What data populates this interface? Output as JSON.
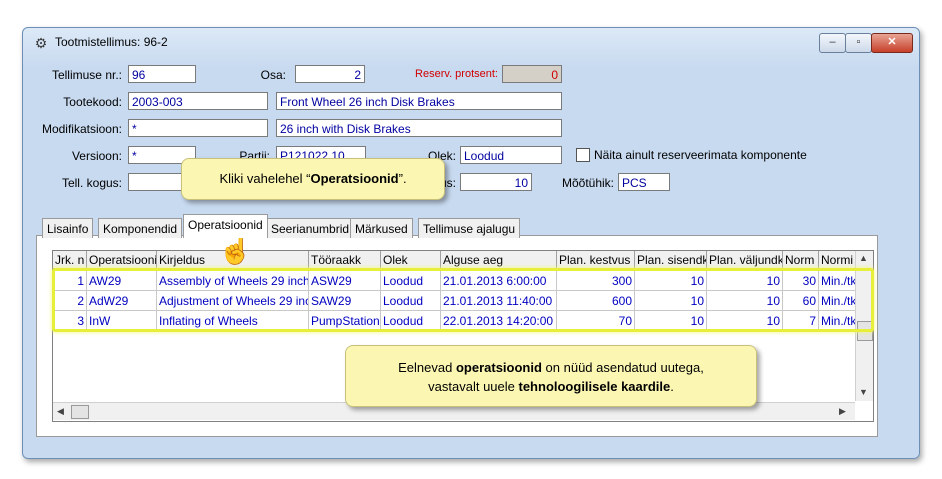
{
  "window": {
    "title": "Tootmistellimus: 96-2",
    "icon": "gear-icon",
    "controls": {
      "minimize": "‒",
      "maximize": "▫",
      "close": "✕"
    }
  },
  "form": {
    "order_nr_label": "Tellimuse nr.:",
    "order_nr_value": "96",
    "part_label": "Osa:",
    "part_value": "2",
    "reserv_label": "Reserv. protsent:",
    "reserv_value": "0",
    "product_code_label": "Tootekood:",
    "product_code_value": "2003-003",
    "product_name": "Front Wheel 26 inch Disk Brakes",
    "modification_label": "Modifikatsioon:",
    "modification_value": "*",
    "modification_desc": "26 inch with Disk Brakes",
    "version_label": "Versioon:",
    "version_value": "*",
    "batch_label_partial": "Partii:",
    "batch_value": "P121022.10",
    "status_label": "Olek:",
    "status_value": "Loodud",
    "show_unreserved_label": "Näita ainult reserveerimata komponente",
    "order_qty_label": "Tell. kogus:",
    "qty_label_partial": "us:",
    "qty_value": "10",
    "unit_label": "Mõõtühik:",
    "unit_value": "PCS"
  },
  "tabs": [
    "Lisainfo",
    "Komponendid",
    "Operatsioonid",
    "Seerianumbrid",
    "Märkused",
    "Tellimuse ajalugu"
  ],
  "active_tab": "Operatsioonid",
  "grid": {
    "headers": [
      "Jrk. n",
      "Operatsiooni",
      "Kirjeldus",
      "Tööraakk",
      "Olek",
      "Alguse aeg",
      "Plan. kestvus",
      "Plan. sisendk",
      "Plan. väljundk",
      "Norm",
      "Normi üh"
    ],
    "rows": [
      [
        "1",
        "AW29",
        "Assembly of Wheels 29 inch",
        "ASW29",
        "Loodud",
        "21.01.2013 6:00:00",
        "300",
        "10",
        "10",
        "30",
        "Min./tk"
      ],
      [
        "2",
        "AdW29",
        "Adjustment of Wheels 29 inc",
        "SAW29",
        "Loodud",
        "21.01.2013 11:40:00",
        "600",
        "10",
        "10",
        "60",
        "Min./tk"
      ],
      [
        "3",
        "InW",
        "Inflating of Wheels",
        "PumpStation",
        "Loodud",
        "22.01.2013 14:20:00",
        "70",
        "10",
        "10",
        "7",
        "Min./tk"
      ]
    ]
  },
  "callouts": {
    "tab_hint_prefix": "Kliki vahelehel “",
    "tab_hint_bold": "Operatsioonid",
    "tab_hint_suffix": "”.",
    "result_1": "Eelnevad ",
    "result_bold1": "operatsioonid",
    "result_2": " on nüüd asendatud uutega,",
    "result_3": "vastavalt uuele ",
    "result_bold2": "tehnoloogilisele kaardile",
    "result_4": "."
  },
  "colors": {
    "highlight": "#e8ef3a",
    "callout_bg": "#fbf7b3",
    "value_blue": "#0000c0",
    "reserv_red": "#d00000"
  }
}
